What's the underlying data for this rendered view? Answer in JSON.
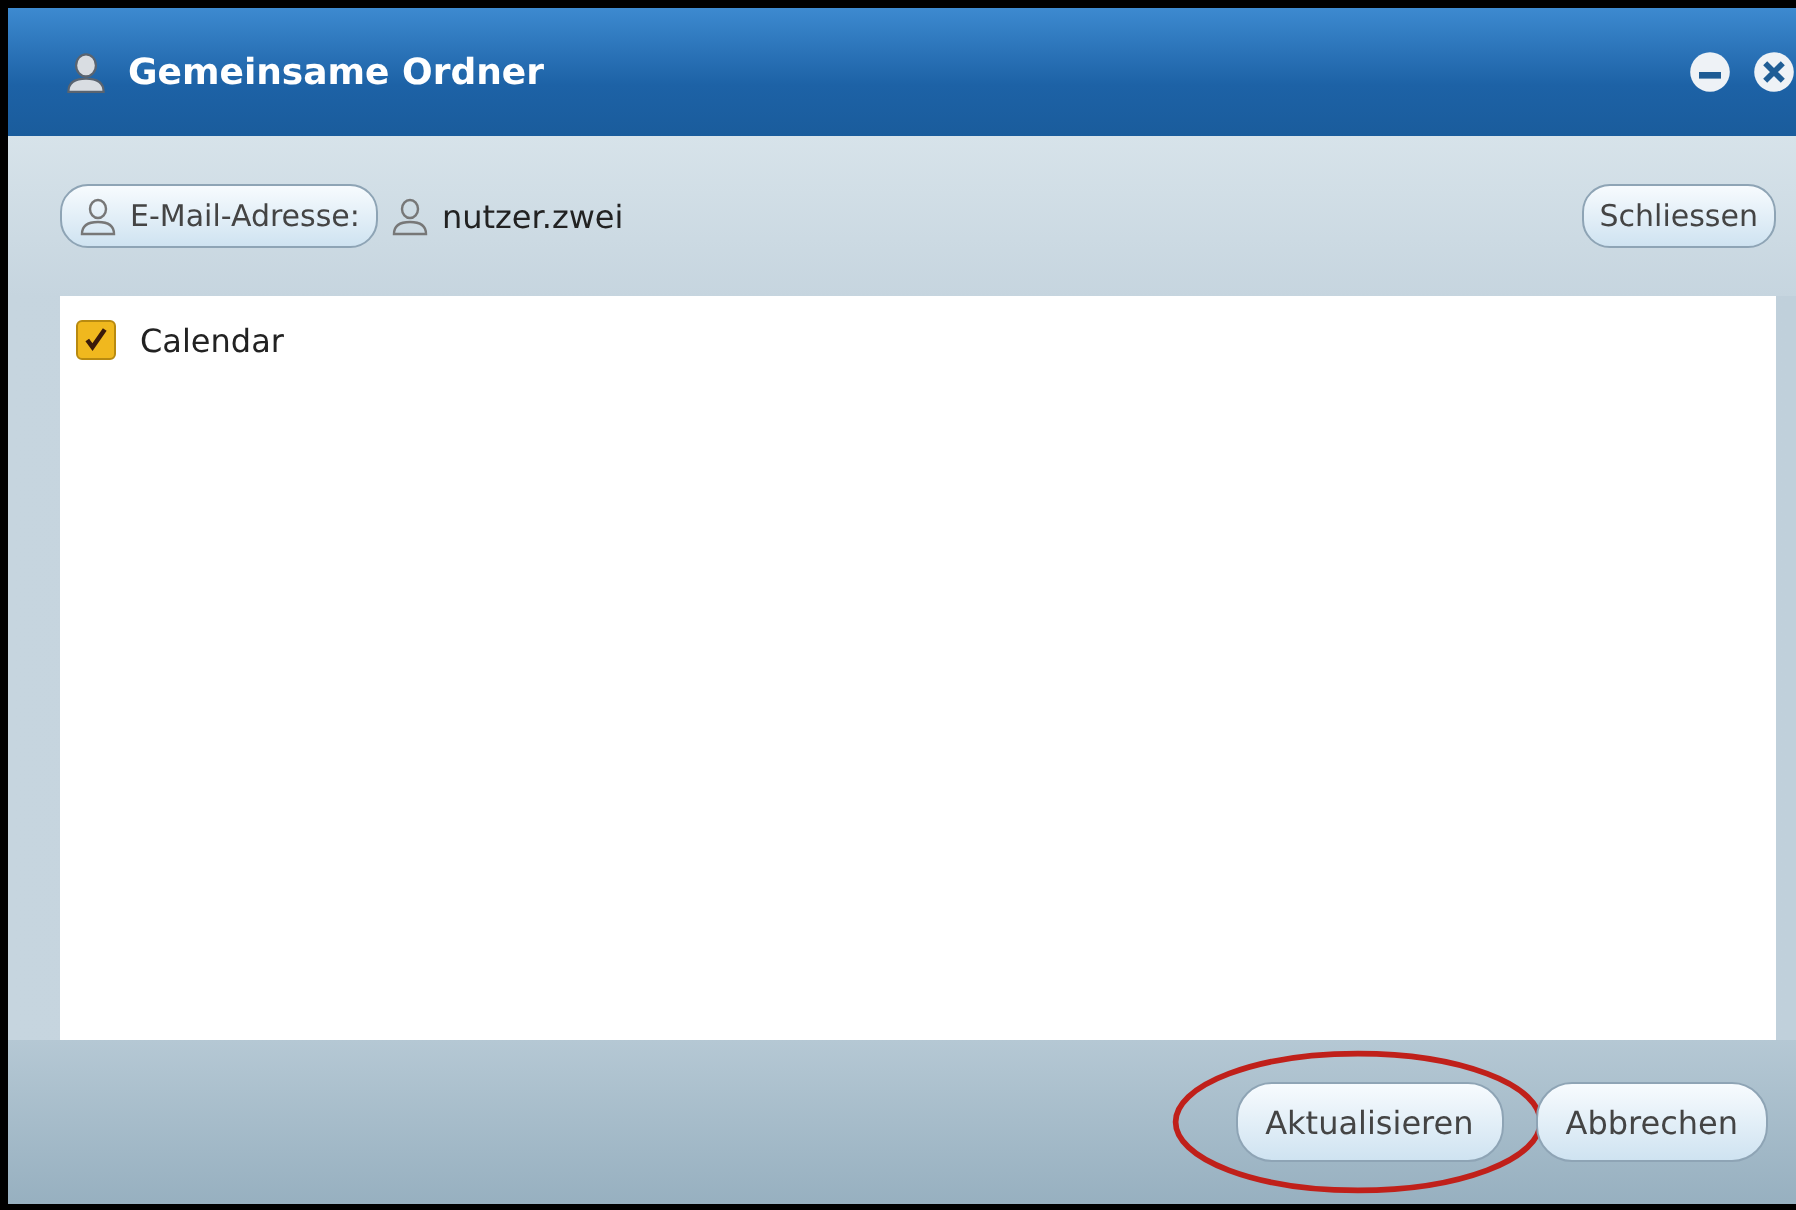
{
  "window": {
    "title": "Gemeinsame Ordner"
  },
  "toolbar": {
    "email_button": "E-Mail-Adresse:",
    "user": "nutzer.zwei",
    "close_button": "Schliessen"
  },
  "folders": [
    {
      "label": "Calendar",
      "checked": true
    }
  ],
  "buttons": [
    {
      "label": "Aktualisieren",
      "highlighted": true
    },
    {
      "label": "Abbrechen",
      "highlighted": false
    }
  ]
}
